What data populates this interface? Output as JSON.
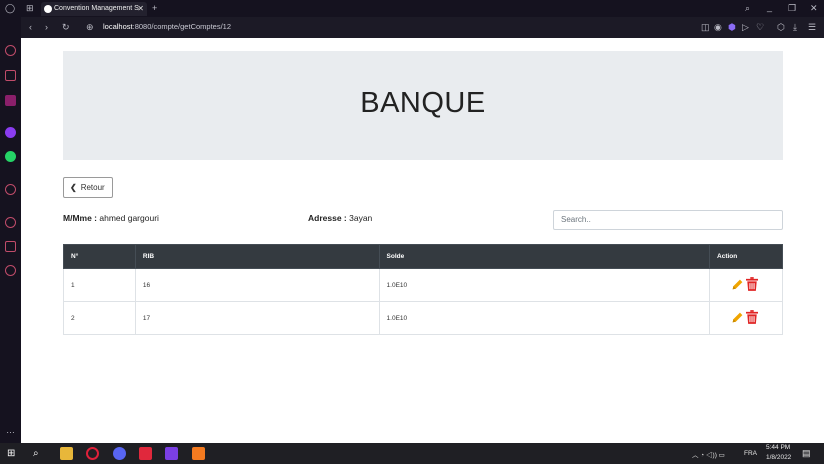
{
  "browser": {
    "tab_title": "Convention Management S",
    "url_host": "localhost",
    "url_path": ":8080/compte/getComptes/12"
  },
  "page": {
    "title": "BANQUE",
    "back_label": "Retour",
    "client_label": "M/Mme :",
    "client_name": "ahmed gargouri",
    "address_label": "Adresse :",
    "address_value": "3ayan",
    "search_placeholder": "Search.."
  },
  "table": {
    "headers": [
      "N°",
      "RIB",
      "Solde",
      "Action"
    ],
    "rows": [
      {
        "num": "1",
        "rib": "16",
        "solde": "1.0E10"
      },
      {
        "num": "2",
        "rib": "17",
        "solde": "1.0E10"
      }
    ]
  },
  "taskbar": {
    "language": "FRA",
    "time": "5:44 PM",
    "date": "1/8/2022"
  },
  "colors": {
    "edit": "#f0a500",
    "delete": "#e02424",
    "table_header": "#343a40",
    "jumbotron": "#e9ecef"
  }
}
